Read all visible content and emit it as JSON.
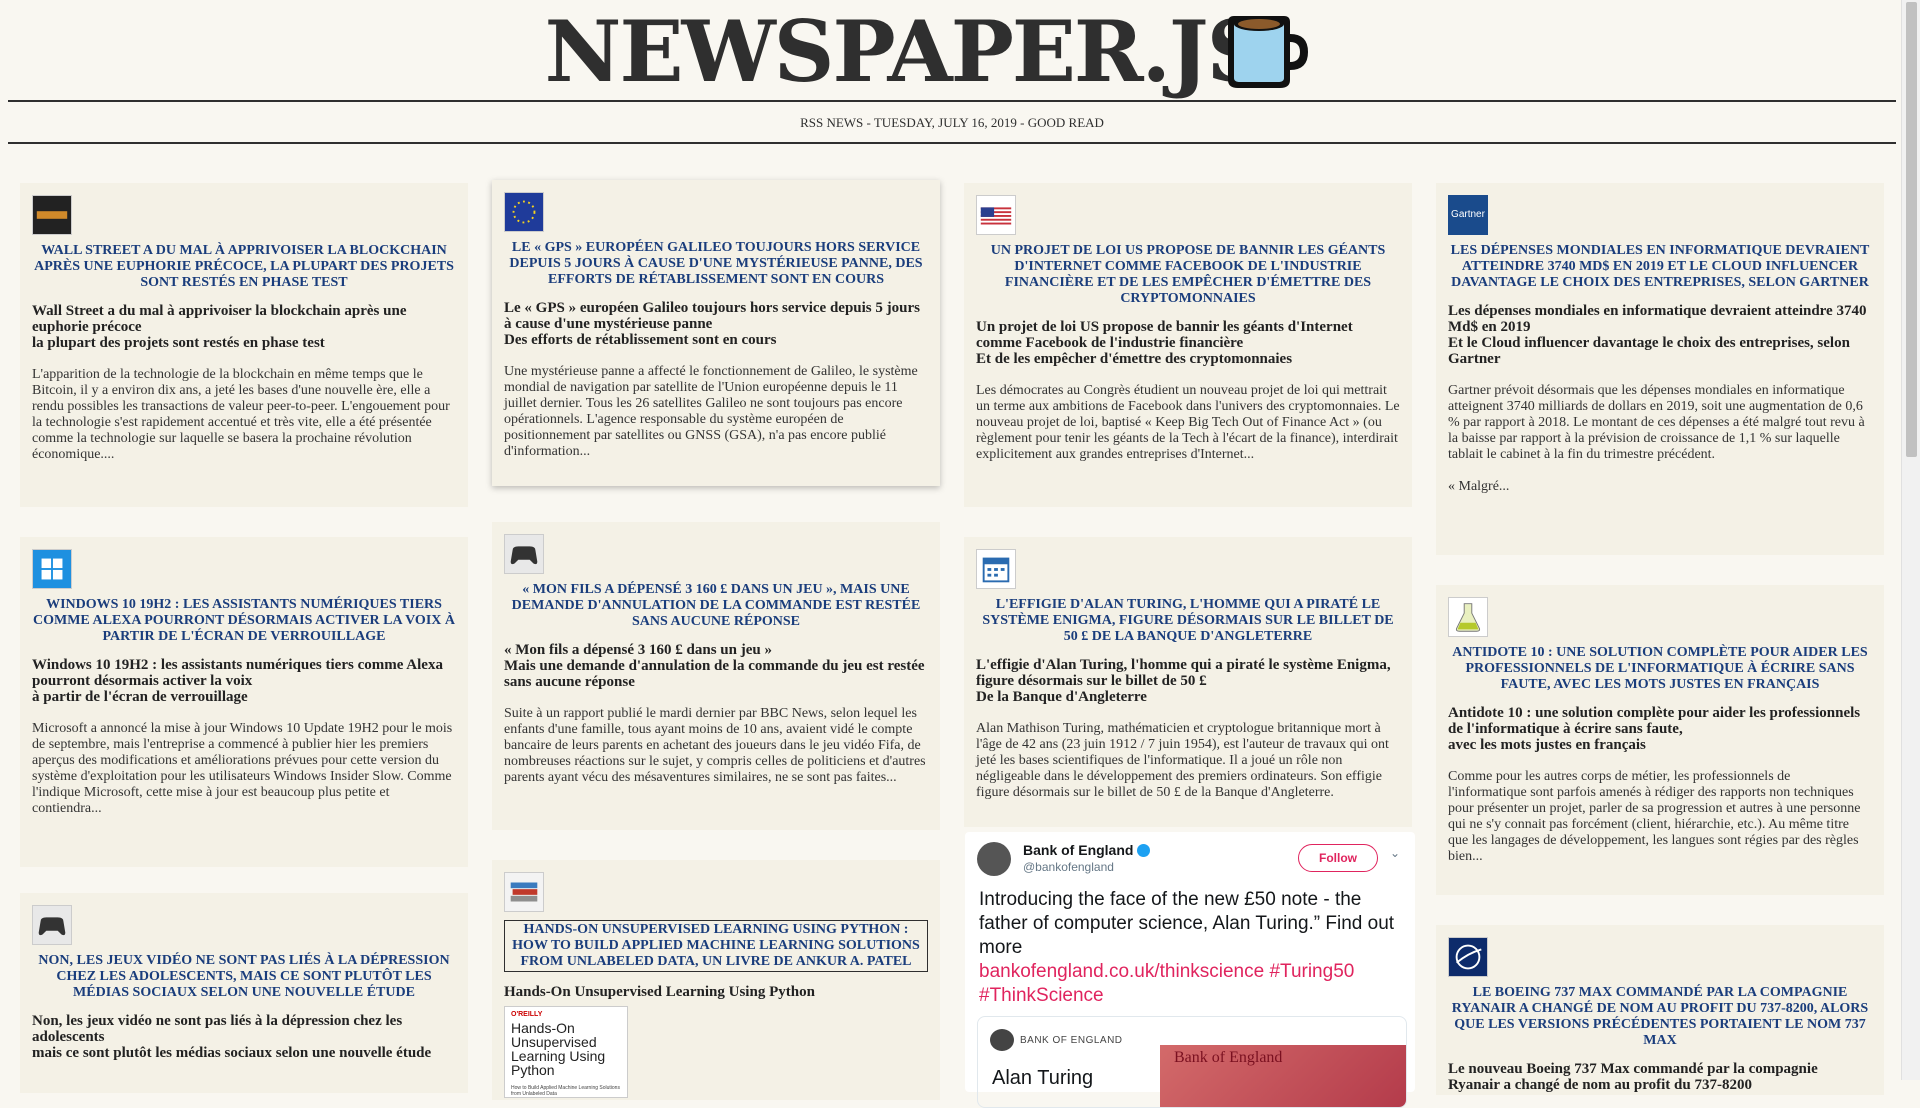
{
  "masthead": {
    "title": "NEWSPAPER.JS",
    "subhead": "RSS NEWS - TUESDAY, JULY 16, 2019 - GOOD READ",
    "icon": "coffee-mug-icon"
  },
  "colors": {
    "background": "#f9f7f1",
    "card": "#f4f1e6",
    "title": "#1a3d7c",
    "text": "#2f2f2f",
    "twitter_accent": "#e0245e"
  },
  "articles": [
    {
      "icon": "blockchain-icon",
      "title": "WALL STREET A DU MAL À APPRIVOISER LA BLOCKCHAIN APRÈS UNE EUPHORIE PRÉCOCE, LA PLUPART DES PROJETS SONT RESTÉS EN PHASE TEST",
      "lead": "Wall Street a du mal à apprivoiser la blockchain après une euphorie précoce\nla plupart des projets sont restés en phase test",
      "body": "L'apparition de la technologie de la blockchain en même temps que le Bitcoin, il y a environ dix ans, a jeté les bases d'une nouvelle ère, elle a rendu possibles les transactions de valeur peer-to-peer. L'engouement pour la technologie s'est rapidement accentué et très vite, elle a été présentée comme la technologie sur laquelle se basera la prochaine révolution économique...."
    },
    {
      "icon": "eu-flag-icon",
      "title": "LE « GPS » EUROPÉEN GALILEO TOUJOURS HORS SERVICE DEPUIS 5 JOURS À CAUSE D'UNE MYSTÉRIEUSE PANNE, DES EFFORTS DE RÉTABLISSEMENT SONT EN COURS",
      "lead": "Le « GPS » européen Galileo toujours hors service depuis 5 jours à cause d'une mystérieuse panne\nDes efforts de rétablissement sont en cours",
      "body": "Une mystérieuse panne a affecté le fonctionnement de Galileo, le système mondial de navigation par satellite de l'Union européenne depuis le 11 juillet dernier. Tous les 26 satellites Galileo ne sont toujours pas encore opérationnels. L'agence responsable du système européen de positionnement par satellites ou GNSS (GSA), n'a pas encore publié d'information..."
    },
    {
      "icon": "us-flag-icon",
      "title": "UN PROJET DE LOI US PROPOSE DE BANNIR LES GÉANTS D'INTERNET COMME FACEBOOK DE L'INDUSTRIE FINANCIÈRE ET DE LES EMPÊCHER D'ÉMETTRE DES CRYPTOMONNAIES",
      "lead": "Un projet de loi US propose de bannir les géants d'Internet comme Facebook de l'industrie financière\nEt de les empêcher d'émettre des cryptomonnaies",
      "body": "Les démocrates au Congrès étudient un nouveau projet de loi qui mettrait un terme aux ambitions de Facebook dans l'univers des cryptomonnaies. Le nouveau projet de loi, baptisé « Keep Big Tech Out of Finance Act » (ou règlement pour tenir les géants de la Tech à l'écart de la finance), interdirait explicitement aux grandes entreprises d'Internet..."
    },
    {
      "icon": "gartner-logo-icon",
      "icon_label": "Gartner",
      "title": "LES DÉPENSES MONDIALES EN INFORMATIQUE DEVRAIENT ATTEINDRE 3740 MD$ EN 2019 ET LE CLOUD INFLUENCER DAVANTAGE LE CHOIX DES ENTREPRISES, SELON GARTNER",
      "lead": "Les dépenses mondiales en informatique devraient atteindre 3740 Md$ en 2019\nEt le Cloud influencer davantage le choix des entreprises, selon Gartner",
      "body": "Gartner prévoit désormais que les dépenses mondiales en informatique atteignent 3740 milliards de dollars en 2019, soit une augmentation de 0,6 % par rapport à 2018. Le montant de ces dépenses a été malgré tout revu à la baisse par rapport à la prévision de croissance de 1,1 % sur laquelle tablait le cabinet à la fin du trimestre précédent.",
      "extra": "« Malgré..."
    },
    {
      "icon": "windows-logo-icon",
      "title": "WINDOWS 10 19H2 : LES ASSISTANTS NUMÉRIQUES TIERS COMME ALEXA POURRONT DÉSORMAIS ACTIVER LA VOIX À PARTIR DE L'ÉCRAN DE VERROUILLAGE",
      "lead": "Windows 10 19H2 : les assistants numériques tiers comme Alexa pourront désormais activer la voix\nà partir de l'écran de verrouillage",
      "body": "Microsoft a annoncé la mise à jour Windows 10 Update 19H2 pour le mois de septembre, mais l'entreprise a commencé à publier hier les premiers aperçus des modifications et améliorations prévues pour cette version du système d'exploitation pour les utilisateurs Windows Insider Slow. Comme l'indique Microsoft, cette mise à jour est beaucoup plus petite et contiendra..."
    },
    {
      "icon": "gamepad-icon",
      "title": "« MON FILS A DÉPENSÉ 3 160 £ DANS UN JEU », MAIS UNE DEMANDE D'ANNULATION DE LA COMMANDE EST RESTÉE SANS AUCUNE RÉPONSE",
      "lead": "« Mon fils a dépensé 3 160 £ dans un jeu »\nMais une demande d'annulation de la commande du jeu est restée sans aucune réponse",
      "body": "Suite à un rapport publié le mardi dernier par BBC News, selon lequel les enfants d'une famille, tous ayant moins de 10 ans, avaient vidé le compte bancaire de leurs parents en achetant des joueurs dans le jeu vidéo Fifa, de nombreuses réactions sur le sujet, y compris celles de politiciens et d'autres parents ayant vécu des mésaventures similaires, ne se sont pas faites..."
    },
    {
      "icon": "calendar-icon",
      "title": "L'EFFIGIE D'ALAN TURING, L'HOMME QUI A PIRATÉ LE SYSTÈME ENIGMA, FIGURE DÉSORMAIS SUR LE BILLET DE 50 £ DE LA BANQUE D'ANGLETERRE",
      "lead": "L'effigie d'Alan Turing, l'homme qui a piraté le système Enigma, figure désormais sur le billet de 50 £\nDe la Banque d'Angleterre",
      "body": "Alan Mathison Turing, mathématicien et cryptologue britannique mort à l'âge de 42 ans (23 juin 1912 / 7 juin 1954), est l'auteur de travaux qui ont jeté les bases scientifiques de l'informatique. Il a joué un rôle non négligeable dans le développement des premiers ordinateurs. Son effigie figure désormais sur le billet de 50 £ de la Banque d'Angleterre."
    },
    {
      "icon": "dictionary-flask-icon",
      "title": "ANTIDOTE 10 : UNE SOLUTION COMPLÈTE POUR AIDER LES PROFESSIONNELS DE L'INFORMATIQUE À ÉCRIRE SANS FAUTE, AVEC LES MOTS JUSTES EN FRANÇAIS",
      "lead": "Antidote 10 : une solution complète pour aider les professionnels de l'informatique à écrire sans faute,\navec les mots justes en français",
      "body": "Comme pour les autres corps de métier, les professionnels de l'informatique sont parfois amenés à rédiger des rapports non techniques pour présenter un projet, parler de sa progression et autres à une personne qui ne s'y connait pas forcément (client, hiérarchie, etc.). Au même titre que les langages de développement, les langues sont régies par des règles bien..."
    },
    {
      "icon": "gamepad-icon",
      "title": "NON, LES JEUX VIDÉO NE SONT PAS LIÉS À LA DÉPRESSION CHEZ LES ADOLESCENTS, MAIS CE SONT PLUTÔT LES MÉDIAS SOCIAUX SELON UNE NOUVELLE ÉTUDE",
      "lead": "Non, les jeux vidéo ne sont pas liés à la dépression chez les adolescents\nmais ce sont plutôt les médias sociaux selon une nouvelle étude"
    },
    {
      "icon": "books-icon",
      "title": "HANDS-ON UNSUPERVISED LEARNING USING PYTHON : HOW TO BUILD APPLIED MACHINE LEARNING SOLUTIONS FROM UNLABELED DATA, UN LIVRE DE ANKUR A. PATEL",
      "lead": "Hands-On Unsupervised Learning Using Python",
      "book": {
        "publisher": "O'REILLY",
        "title": "Hands-On Unsupervised Learning Using Python",
        "subtitle": "How to Build Applied Machine Learning Solutions from Unlabeled Data"
      }
    },
    {
      "icon": "boeing-logo-icon",
      "title": "LE BOEING 737 MAX COMMANDÉ PAR LA COMPAGNIE RYANAIR A CHANGÉ DE NOM AU PROFIT DU 737-8200, ALORS QUE LES VERSIONS PRÉCÉDENTES PORTAIENT LE NOM 737 MAX",
      "lead": "Le nouveau Boeing 737 Max commandé par la compagnie Ryanair a changé de nom au profit du 737-8200"
    }
  ],
  "tweet": {
    "name": "Bank of England",
    "handle": "@bankofengland",
    "follow_label": "Follow",
    "text": "Introducing the face of the new £50 note - the father of computer science, Alan Turing.” Find out more",
    "links": "bankofengland.co.uk/thinkscience #Turing50 #ThinkScience",
    "card_label": "BANK OF ENGLAND",
    "card_note": "Bank of England",
    "card_snippet": "Alan Turing"
  }
}
